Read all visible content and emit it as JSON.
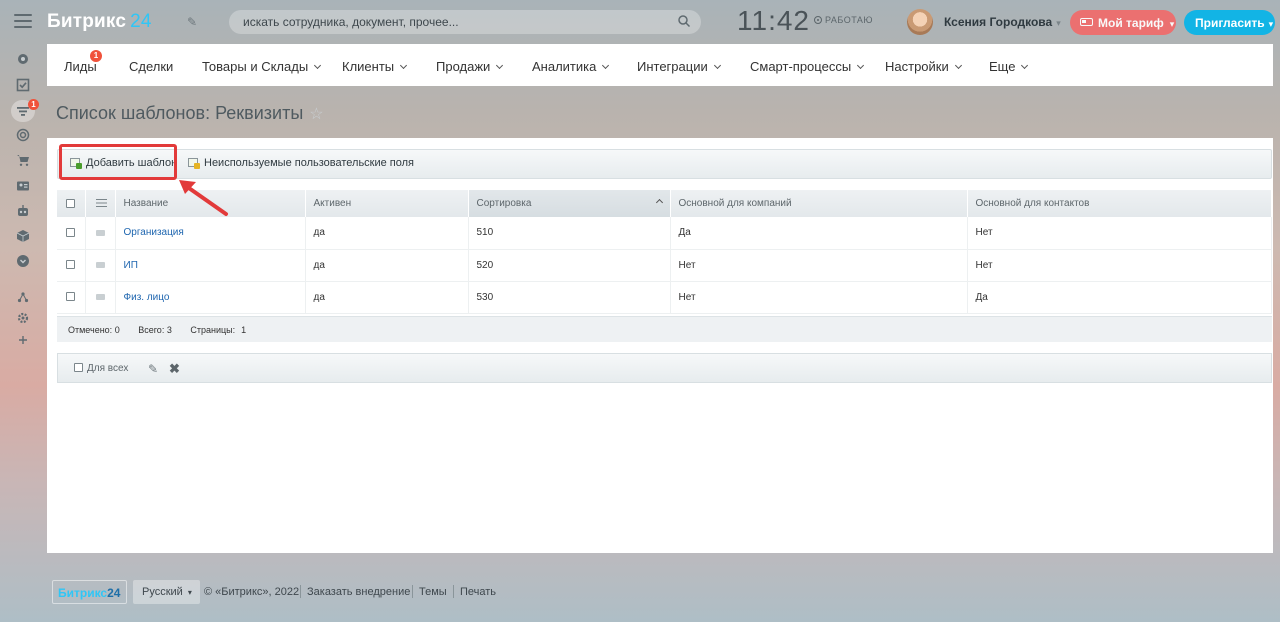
{
  "header": {
    "logo_main": "Битрикс",
    "logo_num": "24",
    "search_placeholder": "искать сотрудника, документ, прочее...",
    "clock": "11:42",
    "work_status": "РАБОТАЮ",
    "user_name": "Ксения Городкова",
    "tariff_label": "Мой тариф",
    "invite_label": "Пригласить"
  },
  "sidebar": {
    "badge": "1",
    "items": [
      "dashboard-icon",
      "tasks-icon",
      "filter-icon",
      "target-icon",
      "cart-icon",
      "contact-card-icon",
      "robot-icon",
      "box-icon",
      "chevron-circle-icon",
      "sitemap-icon",
      "gear-icon",
      "plus-icon"
    ]
  },
  "menu": {
    "items": [
      {
        "label": "Лиды",
        "badge": "1"
      },
      {
        "label": "Сделки"
      },
      {
        "label": "Товары и Склады"
      },
      {
        "label": "Клиенты"
      },
      {
        "label": "Продажи"
      },
      {
        "label": "Аналитика"
      },
      {
        "label": "Интеграции"
      },
      {
        "label": "Смарт-процессы"
      },
      {
        "label": "Настройки"
      },
      {
        "label": "Еще"
      }
    ]
  },
  "page": {
    "title": "Список шаблонов: Реквизиты"
  },
  "toolbar": {
    "add_template": "Добавить шаблон",
    "unused_fields": "Неиспользуемые пользовательские поля"
  },
  "table": {
    "columns": [
      "Название",
      "Активен",
      "Сортировка",
      "Основной для компаний",
      "Основной для контактов"
    ],
    "rows": [
      {
        "name": "Организация",
        "active": "да",
        "sort": "510",
        "company_default": "Да",
        "contact_default": "Нет"
      },
      {
        "name": "ИП",
        "active": "да",
        "sort": "520",
        "company_default": "Нет",
        "contact_default": "Нет"
      },
      {
        "name": "Физ. лицо",
        "active": "да",
        "sort": "530",
        "company_default": "Нет",
        "contact_default": "Да"
      }
    ],
    "footer": {
      "marked": "Отмечено: 0",
      "total": "Всего: 3",
      "pages": "Страницы:",
      "page_num": "1"
    }
  },
  "actions": {
    "for_all": "Для всех"
  },
  "footer": {
    "logo_main": "Битрикс",
    "logo_num": "24",
    "language": "Русский",
    "copyright": "© «Битрикс», 2022",
    "order_link": "Заказать внедрение",
    "themes_link": "Темы",
    "print_link": "Печать"
  },
  "colors": {
    "accent_blue": "#12b4e5",
    "tariff_red": "#f16b6b",
    "highlight_red": "#e23a3a",
    "link_blue": "#2067b0"
  }
}
